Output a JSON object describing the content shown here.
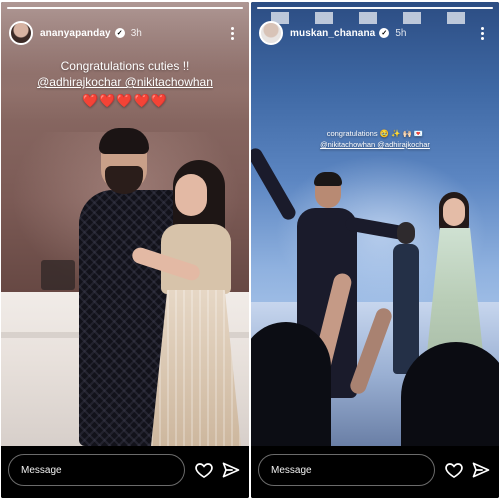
{
  "stories": [
    {
      "username": "ananyapanday",
      "time": "3h",
      "caption_line1": "Congratulations cuties !!",
      "caption_line2": "@adhirajkochar @nikitachowhan",
      "caption_line3": "❤️❤️❤️❤️❤️",
      "message_placeholder": "Message",
      "icons": [
        "avatar",
        "verified-icon",
        "more-icon",
        "heart-icon",
        "send-icon"
      ]
    },
    {
      "username": "muskan_chanana",
      "time": "5h",
      "caption_line1": "congratulations 🥹 ✨ 🙌🏻 💌",
      "caption_line2": "@nikitachowhan @adhirajkochar",
      "message_placeholder": "Message",
      "icons": [
        "avatar",
        "verified-icon",
        "more-icon",
        "heart-icon",
        "send-icon"
      ]
    }
  ],
  "colors": {
    "bar_background": "#000000",
    "text": "#ffffff",
    "heart_emoji_red": "#e3202b"
  }
}
